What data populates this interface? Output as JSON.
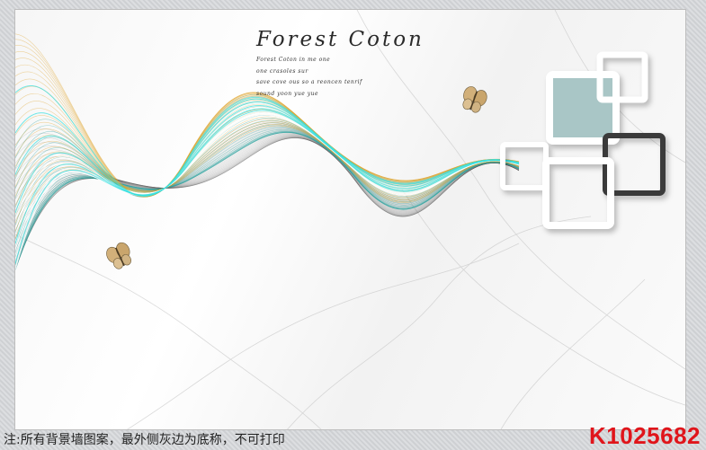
{
  "artwork": {
    "title": "Forest Coton",
    "poem_lines": [
      "Forest Coton in me one",
      "one crasoles sur",
      "save cove ous so a reoncen tenrif",
      "sound yoon yue yue"
    ]
  },
  "footer": {
    "note": "注:所有背景墙图案，最外侧灰边为底称，不可打印",
    "code": "K1025682"
  },
  "colors": {
    "teal": "#2aa3a0",
    "gold": "#e0a52a",
    "charcoal": "#3a3a3a",
    "accent_red": "#e0151b"
  },
  "icons": [
    "butterfly-icon"
  ]
}
